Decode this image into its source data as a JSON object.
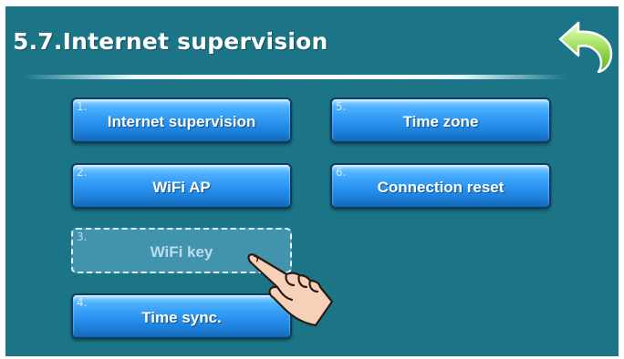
{
  "screen": {
    "title": "5.7.Internet supervision"
  },
  "buttons": [
    {
      "num": "1.",
      "label": "Internet supervision"
    },
    {
      "num": "2.",
      "label": "WiFi AP"
    },
    {
      "num": "3.",
      "label": "WiFi key"
    },
    {
      "num": "4.",
      "label": "Time sync."
    },
    {
      "num": "5.",
      "label": "Time zone"
    },
    {
      "num": "6.",
      "label": "Connection reset"
    }
  ],
  "colors": {
    "panel_background": "#1b7587",
    "button_blue": "#2c96f2",
    "back_arrow": "#8fd44a"
  },
  "icons": {
    "back": "back-arrow-icon",
    "pointer": "pointing-hand-icon"
  },
  "selected_button": "WiFi key"
}
